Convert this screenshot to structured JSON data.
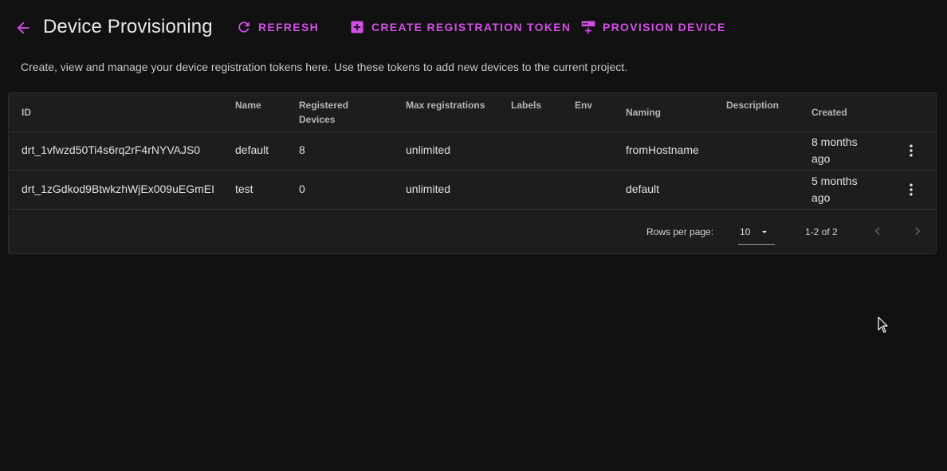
{
  "header": {
    "title": "Device Provisioning",
    "back_icon": "arrow-left-icon",
    "actions": [
      {
        "label": "REFRESH",
        "icon": "refresh-icon"
      },
      {
        "label": "CREATE REGISTRATION TOKEN",
        "icon": "plus-box-icon"
      },
      {
        "label": "PROVISION DEVICE",
        "icon": "provision-device-icon"
      }
    ]
  },
  "description": "Create, view and manage your device registration tokens here. Use these tokens to add new devices to the current project.",
  "table": {
    "columns": {
      "id": "ID",
      "name": "Name",
      "registered_devices_1": "Registered",
      "registered_devices_2": "Devices",
      "max_registrations": "Max registrations",
      "labels": "Labels",
      "env": "Env",
      "naming": "Naming",
      "description": "Description",
      "created": "Created"
    },
    "rows": [
      {
        "id": "drt_1vfwzd50Ti4s6rq2rF4rNYVAJS0",
        "name": "default",
        "registered_devices": "8",
        "max_registrations": "unlimited",
        "labels": "",
        "env": "",
        "naming": "fromHostname",
        "description": "",
        "created_1": "8 months",
        "created_2": "ago"
      },
      {
        "id": "drt_1zGdkod9BtwkzhWjEx009uEGmEI",
        "name": "test",
        "registered_devices": "0",
        "max_registrations": "unlimited",
        "labels": "",
        "env": "",
        "naming": "default",
        "description": "",
        "created_1": "5 months",
        "created_2": "ago"
      }
    ]
  },
  "pagination": {
    "rows_per_page_label": "Rows per page:",
    "rows_per_page_value": "10",
    "range": "1-2 of 2"
  },
  "colors": {
    "accent": "#d24fe6",
    "background": "#121112",
    "card": "#1e1d1e"
  }
}
